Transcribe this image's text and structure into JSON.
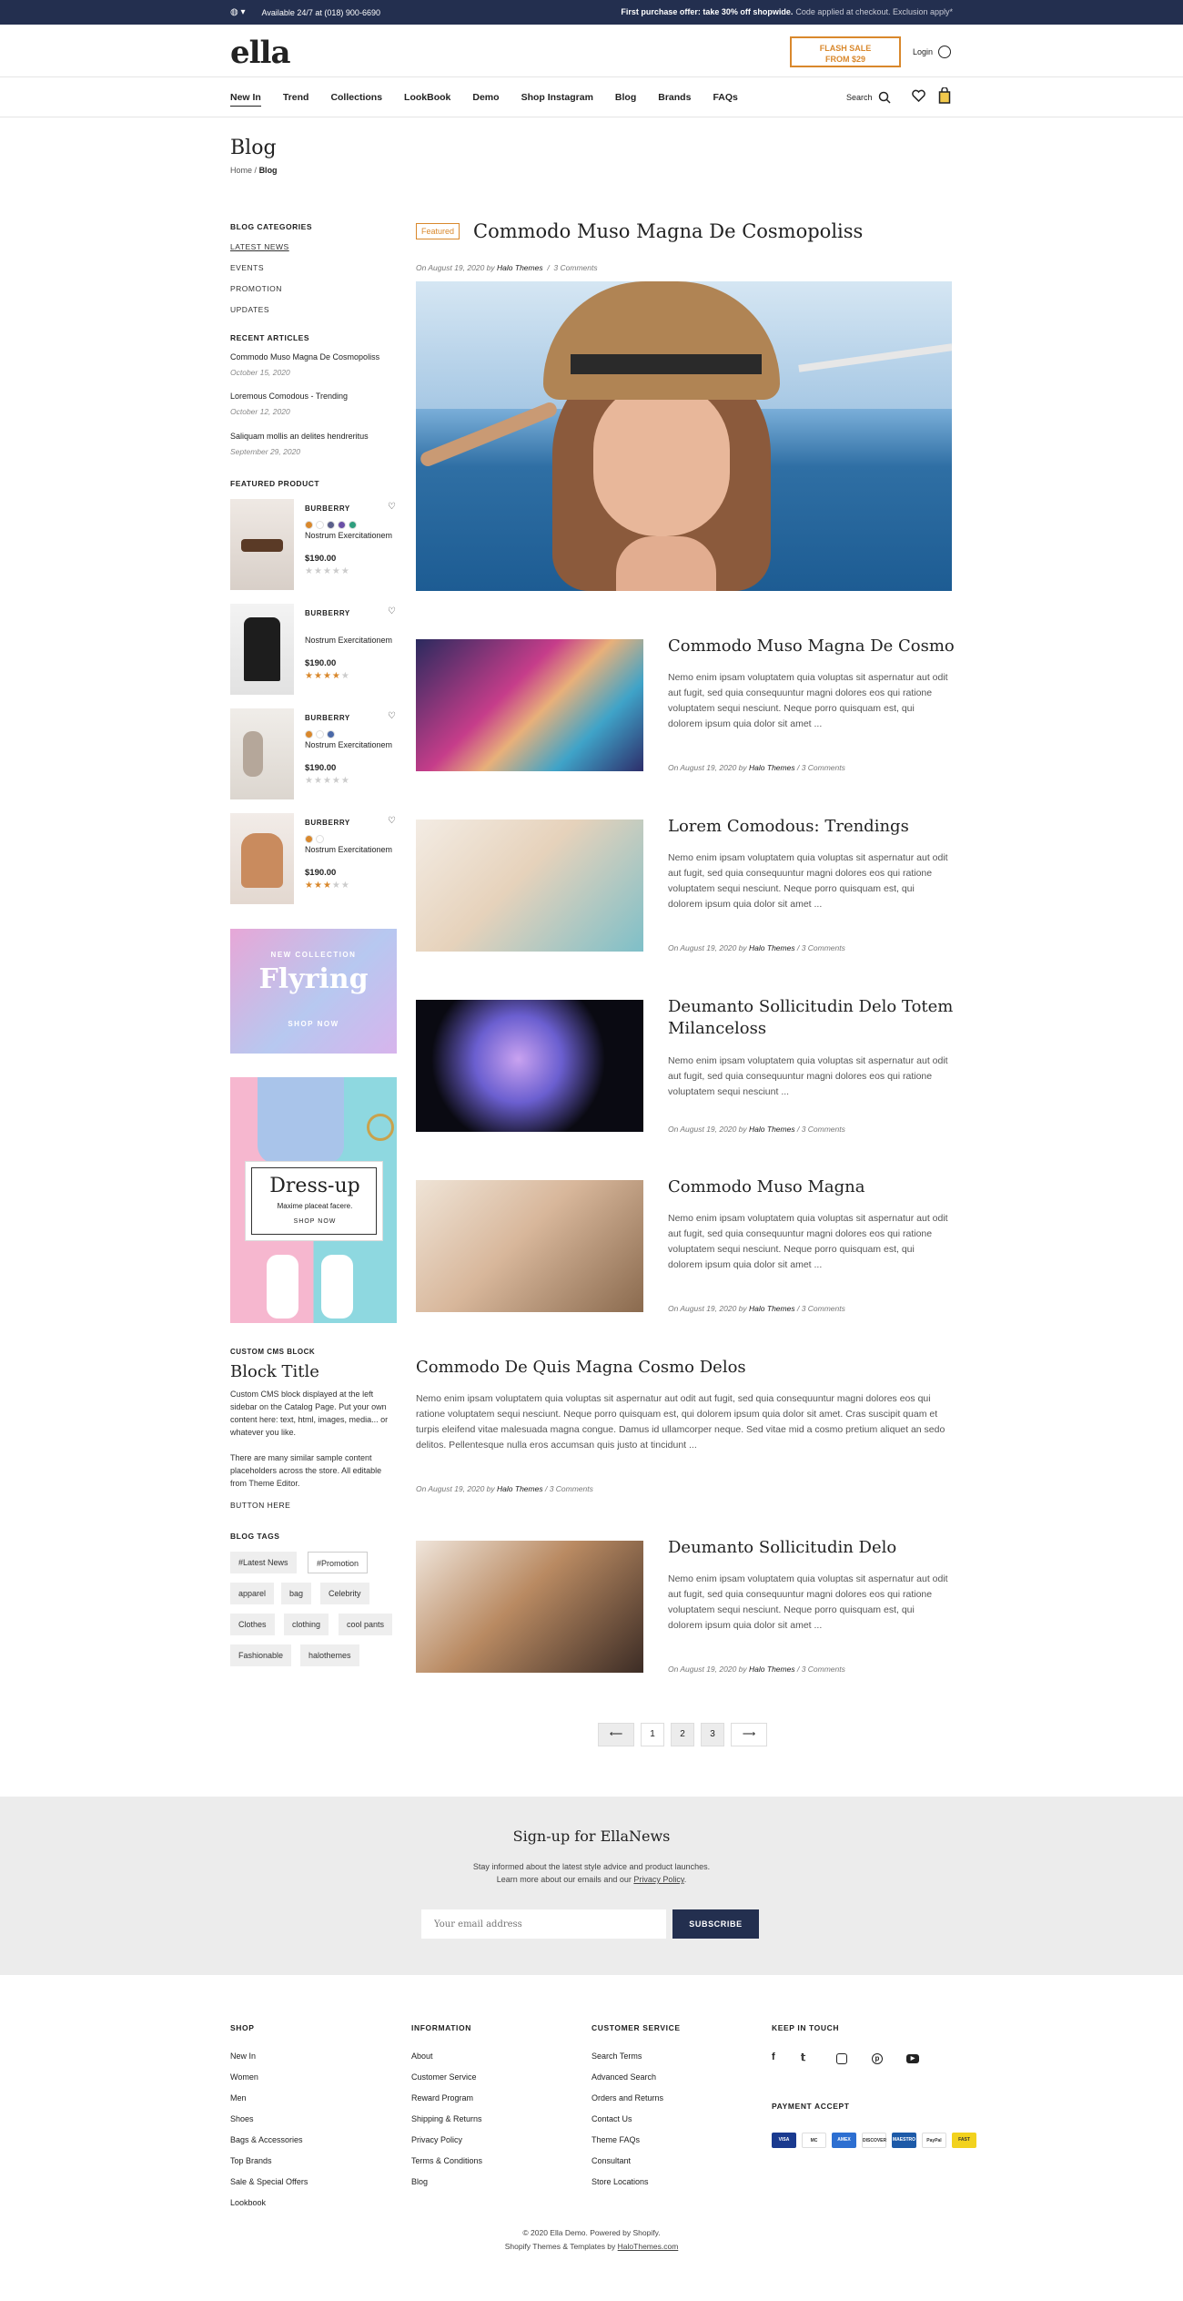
{
  "topbar": {
    "availability": "Available 24/7 at (018) 900-6690",
    "offer": "First purchase offer: take 30% off shopwide.",
    "offer_note": "Code applied at checkout. Exclusion apply*"
  },
  "header": {
    "logo": "ella",
    "flash_line1": "FLASH SALE",
    "flash_line2": "FROM $29",
    "login": "Login",
    "search": "Search",
    "nav": [
      "New In",
      "Trend",
      "Collections",
      "LookBook",
      "Demo",
      "Shop Instagram",
      "Blog",
      "Brands",
      "FAQs"
    ]
  },
  "page": {
    "title": "Blog",
    "crumb_home": "Home",
    "crumb_sep": "/",
    "crumb_current": "Blog"
  },
  "sidebar": {
    "categories_heading": "BLOG CATEGORIES",
    "categories": [
      "LATEST NEWS",
      "EVENTS",
      "PROMOTION",
      "UPDATES"
    ],
    "recent_heading": "RECENT ARTICLES",
    "recent": [
      {
        "title": "Commodo Muso Magna De Cosmopoliss",
        "date": "October 15, 2020"
      },
      {
        "title": "Loremous Comodous - Trending",
        "date": "October 12, 2020"
      },
      {
        "title": "Saliquam mollis an delites hendreritus",
        "date": "September 29, 2020"
      }
    ],
    "featured_heading": "FEATURED PRODUCT",
    "products": [
      {
        "brand": "BURBERRY",
        "name": "Nostrum Exercitationem",
        "price": "$190.00",
        "rating": 0,
        "swatches": [
          "#d9882c",
          "#ffffff",
          "#5a5f8a",
          "#6a4fa6",
          "#2f9e7e"
        ]
      },
      {
        "brand": "BURBERRY",
        "name": "Nostrum Exercitationem",
        "price": "$190.00",
        "rating": 4,
        "swatches": []
      },
      {
        "brand": "BURBERRY",
        "name": "Nostrum Exercitationem",
        "price": "$190.00",
        "rating": 0,
        "swatches": [
          "#d9882c",
          "#ffffff",
          "#4a69a8"
        ]
      },
      {
        "brand": "BURBERRY",
        "name": "Nostrum Exercitationem",
        "price": "$190.00",
        "rating": 3,
        "swatches": [
          "#d9882c",
          "#ffffff"
        ]
      }
    ],
    "banner1": {
      "kicker": "NEW COLLECTION",
      "title": "Flyring",
      "cta": "SHOP NOW"
    },
    "banner2": {
      "title": "Dress-up",
      "sub": "Maxime placeat facere.",
      "cta": "SHOP NOW"
    },
    "cms": {
      "label": "CUSTOM CMS BLOCK",
      "title": "Block Title",
      "p1": "Custom CMS block displayed at the left sidebar on the Catalog Page. Put your own content here: text, html, images, media... or whatever you like.",
      "p2": "There are many similar sample content placeholders across the store. All editable from Theme Editor.",
      "button": "BUTTON HERE"
    },
    "tags_heading": "BLOG TAGS",
    "tags": [
      "#Latest News",
      "#Promotion",
      "apparel",
      "bag",
      "Celebrity",
      "Clothes",
      "clothing",
      "cool pants",
      "Fashionable",
      "halothemes"
    ]
  },
  "featured_post": {
    "badge": "Featured",
    "title": "Commodo Muso Magna De Cosmopoliss",
    "date": "On August 19, 2020",
    "by": "by",
    "author": "Halo Themes",
    "comments": "3 Comments"
  },
  "posts": [
    {
      "title": "Commodo Muso Magna De Cosmo",
      "excerpt": "Nemo enim ipsam voluptatem quia voluptas sit aspernatur aut odit aut fugit, sed quia consequuntur magni dolores eos qui ratione voluptatem sequi nesciunt. Neque porro quisquam est, qui dolorem ipsum quia dolor sit amet ...",
      "date": "On August 19, 2020",
      "author": "Halo Themes",
      "comments": "3 Comments"
    },
    {
      "title": "Lorem Comodous: Trendings",
      "excerpt": "Nemo enim ipsam voluptatem quia voluptas sit aspernatur aut odit aut fugit, sed quia consequuntur magni dolores eos qui ratione voluptatem sequi nesciunt. Neque porro quisquam est, qui dolorem ipsum quia dolor sit amet ...",
      "date": "On August 19, 2020",
      "author": "Halo Themes",
      "comments": "3 Comments"
    },
    {
      "title": "Deumanto Sollicitudin Delo Totem Milanceloss",
      "excerpt": "Nemo enim ipsam voluptatem quia voluptas sit aspernatur aut odit aut fugit, sed quia consequuntur magni dolores eos qui ratione voluptatem sequi nesciunt ...",
      "date": "On August 19, 2020",
      "author": "Halo Themes",
      "comments": "3 Comments"
    },
    {
      "title": "Commodo Muso Magna",
      "excerpt": "Nemo enim ipsam voluptatem quia voluptas sit aspernatur aut odit aut fugit, sed quia consequuntur magni dolores eos qui ratione voluptatem sequi nesciunt. Neque porro quisquam est, qui dolorem ipsum quia dolor sit amet ...",
      "date": "On August 19, 2020",
      "author": "Halo Themes",
      "comments": "3 Comments"
    },
    {
      "title": "Commodo De Quis Magna Cosmo Delos",
      "excerpt": "Nemo enim ipsam voluptatem quia voluptas sit aspernatur aut odit aut fugit, sed quia consequuntur magni dolores eos qui ratione voluptatem sequi nesciunt. Neque porro quisquam est, qui dolorem ipsum quia dolor sit amet. Cras suscipit quam et turpis eleifend vitae malesuada magna congue. Damus id ullamcorper neque. Sed vitae mid a cosmo pretium aliquet an sedo delitos. Pellentesque nulla eros accumsan quis justo at tincidunt ...",
      "date": "On August 19, 2020",
      "author": "Halo Themes",
      "comments": "3 Comments"
    },
    {
      "title": "Deumanto Sollicitudin Delo",
      "excerpt": "Nemo enim ipsam voluptatem quia voluptas sit aspernatur aut odit aut fugit, sed quia consequuntur magni dolores eos qui ratione voluptatem sequi nesciunt. Neque porro quisquam est, qui dolorem ipsum quia dolor sit amet ...",
      "date": "On August 19, 2020",
      "author": "Halo Themes",
      "comments": "3 Comments"
    }
  ],
  "pagination": {
    "prev": "⟵",
    "pages": [
      "1",
      "2",
      "3"
    ],
    "next": "⟶"
  },
  "newsletter": {
    "title": "Sign-up for EllaNews",
    "line1": "Stay informed about the latest style advice and product launches.",
    "line2": "Learn more about our emails and our",
    "policy": "Privacy Policy",
    "placeholder": "Your email address",
    "button": "SUBSCRIBE"
  },
  "footer": {
    "shop_heading": "SHOP",
    "shop": [
      "New In",
      "Women",
      "Men",
      "Shoes",
      "Bags & Accessories",
      "Top Brands",
      "Sale & Special Offers",
      "Lookbook"
    ],
    "info_heading": "INFORMATION",
    "info": [
      "About",
      "Customer Service",
      "Reward Program",
      "Shipping & Returns",
      "Privacy Policy",
      "Terms & Conditions",
      "Blog"
    ],
    "service_heading": "CUSTOMER SERVICE",
    "service": [
      "Search Terms",
      "Advanced Search",
      "Orders and Returns",
      "Contact Us",
      "Theme FAQs",
      "Consultant",
      "Store Locations"
    ],
    "keep_heading": "KEEP IN TOUCH",
    "social_icons": [
      "facebook-icon",
      "twitter-icon",
      "instagram-icon",
      "pinterest-icon",
      "youtube-icon"
    ],
    "payment_heading": "PAYMENT ACCEPT",
    "payments": [
      "VISA",
      "MC",
      "AMEX",
      "DISCOVER",
      "MAESTRO",
      "PayPal",
      "FAST"
    ],
    "payment_colors": [
      "#1a3a8f",
      "#ffffff",
      "#2d6fd1",
      "#ffffff",
      "#1d5aa8",
      "#ffffff",
      "#f2d21e"
    ],
    "copy1": "© 2020 Ella Demo. Powered by Shopify.",
    "copy2_prefix": "Shopify Themes & Templates by",
    "copy2_link": "HaloThemes.com"
  },
  "colors": {
    "navy": "#232f4f",
    "accent": "#d9882c"
  }
}
